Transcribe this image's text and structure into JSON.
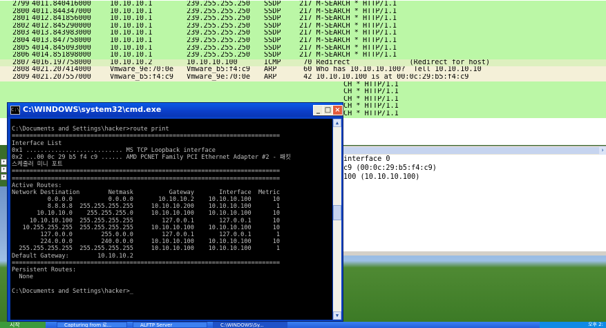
{
  "packets": [
    {
      "no": "2799",
      "time": "4011.840416000",
      "src": "10.10.10.1",
      "dst": "239.255.255.250",
      "proto": "SSDP",
      "info": "217 M-SEARCH * HTTP/1.1",
      "color": "#bbf7a6"
    },
    {
      "no": "2800",
      "time": "4011.844347000",
      "src": "10.10.10.1",
      "dst": "239.255.255.250",
      "proto": "SSDP",
      "info": "217 M-SEARCH * HTTP/1.1",
      "color": "#bbf7a6"
    },
    {
      "no": "2801",
      "time": "4012.841856000",
      "src": "10.10.10.1",
      "dst": "239.255.255.250",
      "proto": "SSDP",
      "info": "217 M-SEARCH * HTTP/1.1",
      "color": "#bbf7a6"
    },
    {
      "no": "2802",
      "time": "4012.845290000",
      "src": "10.10.10.1",
      "dst": "239.255.255.250",
      "proto": "SSDP",
      "info": "217 M-SEARCH * HTTP/1.1",
      "color": "#bbf7a6"
    },
    {
      "no": "2803",
      "time": "4013.843983000",
      "src": "10.10.10.1",
      "dst": "239.255.255.250",
      "proto": "SSDP",
      "info": "217 M-SEARCH * HTTP/1.1",
      "color": "#bbf7a6"
    },
    {
      "no": "2804",
      "time": "4013.847758000",
      "src": "10.10.10.1",
      "dst": "239.255.255.250",
      "proto": "SSDP",
      "info": "217 M-SEARCH * HTTP/1.1",
      "color": "#bbf7a6"
    },
    {
      "no": "2805",
      "time": "4014.845093000",
      "src": "10.10.10.1",
      "dst": "239.255.255.250",
      "proto": "SSDP",
      "info": "217 M-SEARCH * HTTP/1.1",
      "color": "#bbf7a6"
    },
    {
      "no": "2806",
      "time": "4014.851898000",
      "src": "10.10.10.1",
      "dst": "239.255.255.250",
      "proto": "SSDP",
      "info": "217 M-SEARCH * HTTP/1.1",
      "color": "#bbf7a6"
    },
    {
      "no": "2807",
      "time": "4016.197758000",
      "src": "10.10.10.2",
      "dst": "10.10.10.100",
      "proto": "ICMP",
      "info": " 70 Redirect              (Redirect for host)",
      "color": "#ddf0bf"
    },
    {
      "no": "2808",
      "time": "4021.207414000",
      "src": "Vmware_9e:70:0e",
      "dst": "Vmware_b5:f4:c9",
      "proto": "ARP",
      "info": " 60 Who has 10.10.10.100?  Tell 10.10.10.10",
      "color": "#f4f0d8"
    },
    {
      "no": "2809",
      "time": "4021.207557000",
      "src": "Vmware_b5:f4:c9",
      "dst": "Vmware_9e:70:0e",
      "proto": "ARP",
      "info": " 42 10.10.10.100 is at 00:0c:29:b5:f4:c9",
      "color": "#f4f0d8"
    }
  ],
  "partial_rows": [
    {
      "info": "CH * HTTP/1.1"
    },
    {
      "info": "CH * HTTP/1.1"
    },
    {
      "info": "CH * HTTP/1.1"
    },
    {
      "info": "CH * HTTP/1.1"
    },
    {
      "info": "CH * HTTP/1.1"
    }
  ],
  "detail_lines": [
    "interface 0",
    "c9 (00:0c:29:b5:f4:c9)",
    "100 (10.10.10.100)"
  ],
  "cmd": {
    "title": "C:\\WINDOWS\\system32\\cmd.exe",
    "lines": [
      "",
      "C:\\Documents and Settings\\hacker>route print",
      "===========================================================================",
      "Interface List",
      "0x1 ........................... MS TCP Loopback interface",
      "0x2 ...00 0c 29 b5 f4 c9 ...... AMD PCNET Family PCI Ethernet Adapter #2 - 패킷",
      "스케줄러 미니 포트",
      "===========================================================================",
      "===========================================================================",
      "Active Routes:",
      "Network Destination        Netmask          Gateway       Interface  Metric",
      "          0.0.0.0          0.0.0.0       10.10.10.2    10.10.10.100      10",
      "          8.8.8.8  255.255.255.255     10.10.10.200    10.10.10.100       1",
      "       10.10.10.0    255.255.255.0     10.10.10.100    10.10.10.100      10",
      "     10.10.10.100  255.255.255.255        127.0.0.1       127.0.0.1      10",
      "   10.255.255.255  255.255.255.255     10.10.10.100    10.10.10.100      10",
      "        127.0.0.0        255.0.0.0        127.0.0.1       127.0.0.1       1",
      "        224.0.0.0        240.0.0.0     10.10.10.100    10.10.10.100      10",
      "  255.255.255.255  255.255.255.255     10.10.10.100    10.10.10.100       1",
      "Default Gateway:        10.10.10.2",
      "===========================================================================",
      "Persistent Routes:",
      "  None",
      "",
      "C:\\Documents and Settings\\hacker>_"
    ]
  },
  "taskbar": {
    "start_label": "시작",
    "items": [
      "Capturing from 로...",
      "ALFTP Server",
      "C:\\WINDOWS\\Sy..."
    ],
    "clock": "오후 2:"
  }
}
